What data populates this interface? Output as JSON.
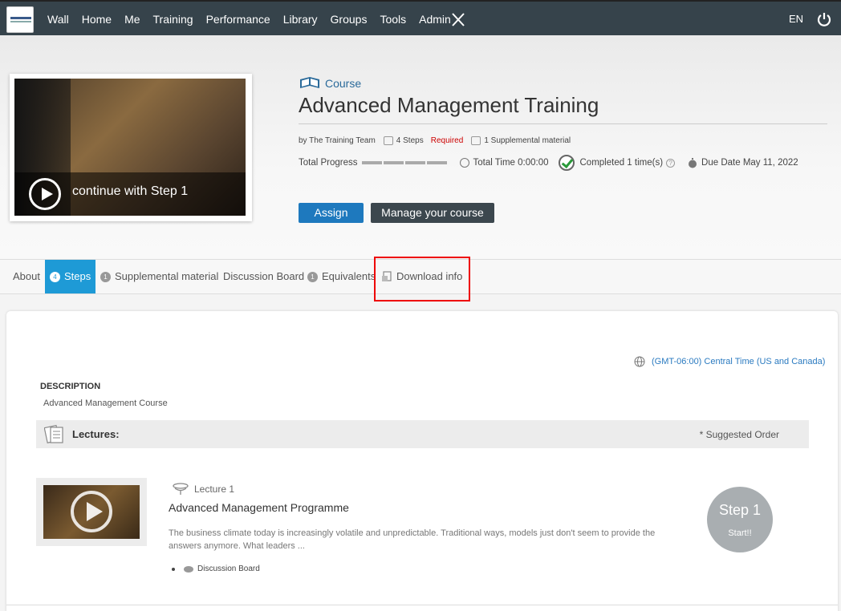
{
  "nav": {
    "items": [
      "Wall",
      "Home",
      "Me",
      "Training",
      "Performance",
      "Library",
      "Groups",
      "Tools",
      "Admin"
    ],
    "language": "EN"
  },
  "hero": {
    "continue_label": "continue with Step 1"
  },
  "course": {
    "type_label": "Course",
    "title": "Advanced Management Training",
    "author": "by The Training Team",
    "steps": "4 Steps",
    "required": "Required",
    "supplemental": "1 Supplemental material",
    "progress_label": "Total Progress",
    "progress_segments": 4,
    "total_time": "Total Time 0:00:00",
    "completed": "Completed 1 time(s)",
    "due_date": "Due Date May 11, 2022"
  },
  "buttons": {
    "assign": "Assign",
    "manage": "Manage your course"
  },
  "tabs": {
    "about": "About",
    "steps": "Steps",
    "steps_count": "4",
    "supplemental": "Supplemental material",
    "supplemental_count": "1",
    "discussion": "Discussion Board",
    "equivalents": "Equivalents",
    "equivalents_count": "1",
    "download": "Download info"
  },
  "content": {
    "timezone": "(GMT-06:00) Central Time (US and Canada)",
    "description_heading": "DESCRIPTION",
    "description": "Advanced Management Course",
    "lectures_label": "Lectures:",
    "suggested_order": "* Suggested Order"
  },
  "lecture": {
    "number": "Lecture 1",
    "title": "Advanced Management Programme",
    "description": "The business climate today is increasingly volatile and unpredictable. Traditional ways, models just don't seem to provide the answers anymore. What leaders ...",
    "link": "Discussion Board",
    "step_label": "Step 1",
    "step_action": "Start!!"
  },
  "colors": {
    "nav_bg": "#36434b",
    "accent": "#1e9ad6",
    "assign_button": "#1e79be",
    "manage_button": "#3c474e",
    "required": "#cc0000",
    "highlight_box": "#ee0000",
    "step_circle": "#a9aeb1"
  }
}
